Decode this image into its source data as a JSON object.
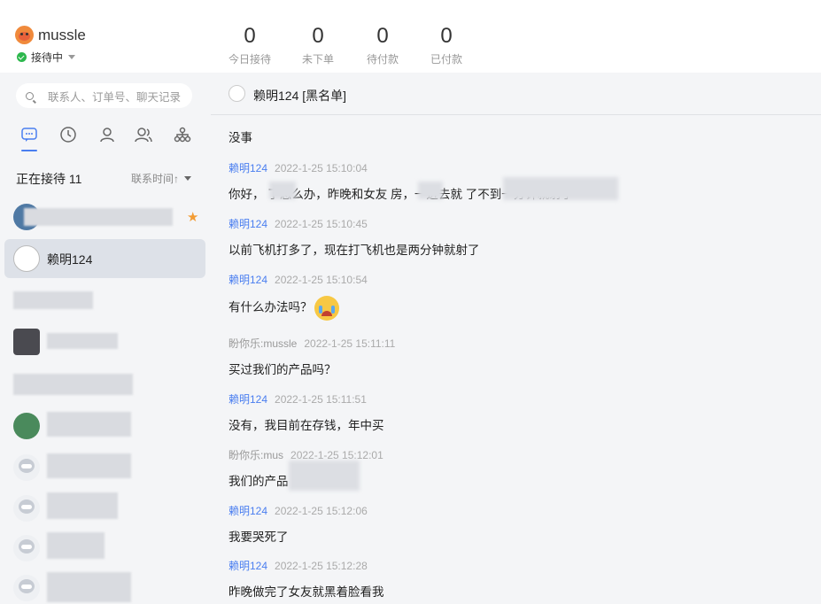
{
  "header": {
    "brand_name": "mussle",
    "status_label": "接待中",
    "stats": [
      {
        "value": "0",
        "label": "今日接待"
      },
      {
        "value": "0",
        "label": "未下单"
      },
      {
        "value": "0",
        "label": "待付款"
      },
      {
        "value": "0",
        "label": "已付款"
      }
    ]
  },
  "sidebar": {
    "search_placeholder": "联系人、订单号、聊天记录",
    "tabs": [
      "chat-bubble-icon",
      "clock-icon",
      "user-icon",
      "group-icon",
      "org-icon"
    ],
    "queue_title": "正在接待 11",
    "sort_label": "联系时间↑",
    "active_contact": "赖明124"
  },
  "chat": {
    "title": "赖明124 [黑名单]",
    "first_text": "没事",
    "messages": [
      {
        "sender": "赖明124",
        "time": "2022-1-25 15:10:04",
        "text": "你好，       了怎么办，昨晚和女友     房，一进去就                              了不到一分钟就射了"
      },
      {
        "sender": "赖明124",
        "time": "2022-1-25 15:10:45",
        "text": "以前飞机打多了，现在打飞机也是两分钟就射了"
      },
      {
        "sender": "赖明124",
        "time": "2022-1-25 15:10:54",
        "text": "有什么办法吗？"
      },
      {
        "sender": "盼你乐:mussle",
        "time": "2022-1-25 15:11:11",
        "text": "买过我们的产品吗？"
      },
      {
        "sender": "赖明124",
        "time": "2022-1-25 15:11:51",
        "text": "没有，我目前在存钱，年中买"
      },
      {
        "sender": "盼你乐:mus",
        "time": "2022-1-25 15:12:01",
        "text": "我们的产品"
      },
      {
        "sender": "赖明124",
        "time": "2022-1-25 15:12:06",
        "text": "我要哭死了"
      },
      {
        "sender": "赖明124",
        "time": "2022-1-25 15:12:28",
        "text": "昨晚做完了女友就黑着脸看我"
      }
    ]
  }
}
